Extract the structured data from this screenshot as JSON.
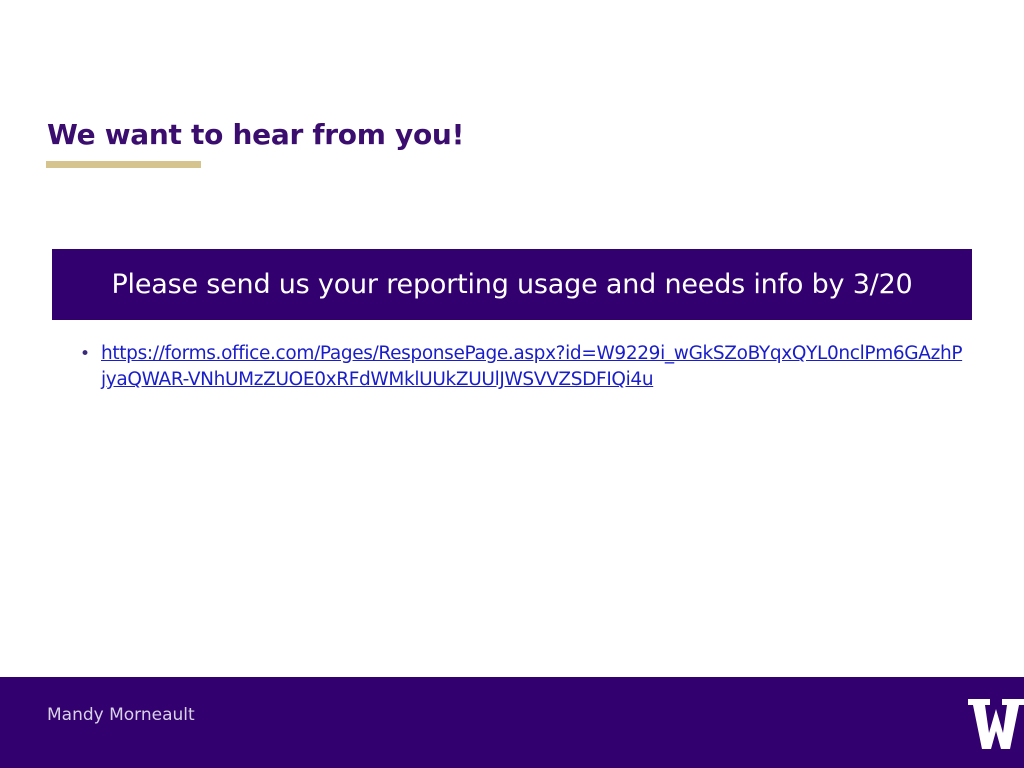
{
  "slide": {
    "title": "We want to hear from you!",
    "banner_text": "Please send us your reporting usage and needs info by 3/20",
    "bullets": [
      {
        "bullet": "•",
        "link_text": "https://forms.office.com/Pages/ResponsePage.aspx?id=W9229i_wGkSZoBYqxQYL0nclPm6GAzhPjyaQWAR-VNhUMzZUOE0xRFdWMklUUkZUUlJWSVVZSDFIQi4u"
      }
    ]
  },
  "footer": {
    "author": "Mandy Morneault",
    "logo_icon": "uw-w-logo-icon"
  },
  "colors": {
    "title": "#3a0d6e",
    "accent_underline": "#d6c48f",
    "banner_bg": "#33006f",
    "link": "#1a1ec9",
    "footer_bg": "#33006f"
  }
}
